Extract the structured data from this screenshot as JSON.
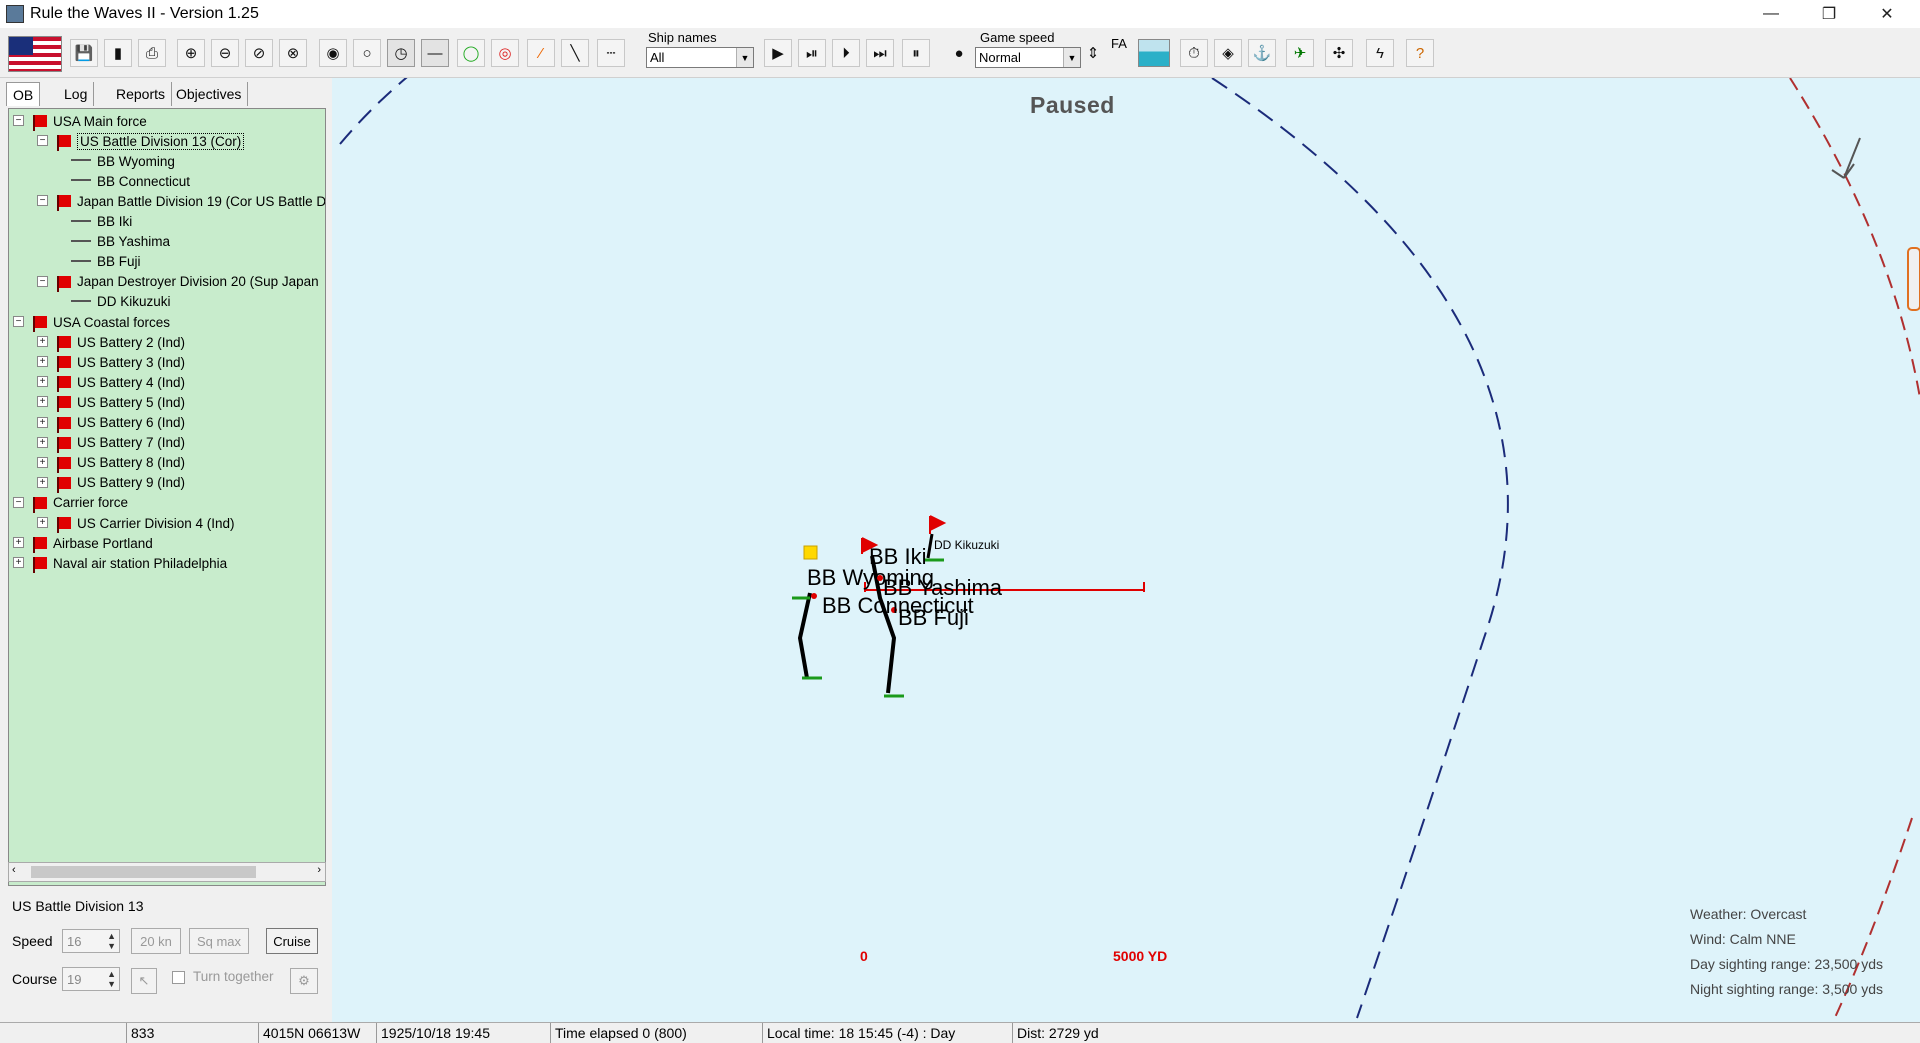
{
  "window": {
    "title": "Rule the Waves II - Version 1.25",
    "min": "—",
    "restore": "❐",
    "close": "✕"
  },
  "toolbar": {
    "ship_names_label": "Ship names",
    "ship_names_value": "All",
    "game_speed_label": "Game speed",
    "game_speed_value": "Normal",
    "fa_label": "FA"
  },
  "tabs": [
    "OB",
    "Log",
    "Reports",
    "Objectives"
  ],
  "tree": [
    {
      "label": "USA Main force",
      "level": 0,
      "exp": "−",
      "icon": "flag"
    },
    {
      "label": "US Battle Division 13 (Cor)",
      "level": 1,
      "exp": "−",
      "icon": "flag",
      "selected": true
    },
    {
      "label": "BB Wyoming",
      "level": 2,
      "icon": "ship"
    },
    {
      "label": "BB Connecticut",
      "level": 2,
      "icon": "ship"
    },
    {
      "label": "Japan Battle Division 19 (Cor US Battle D",
      "level": 1,
      "exp": "−",
      "icon": "flag"
    },
    {
      "label": "BB Iki",
      "level": 2,
      "icon": "ship"
    },
    {
      "label": "BB Yashima",
      "level": 2,
      "icon": "ship"
    },
    {
      "label": "BB Fuji",
      "level": 2,
      "icon": "ship"
    },
    {
      "label": "Japan Destroyer Division 20 (Sup Japan",
      "level": 1,
      "exp": "−",
      "icon": "flag"
    },
    {
      "label": "DD Kikuzuki",
      "level": 2,
      "icon": "ship"
    },
    {
      "label": "USA Coastal forces",
      "level": 0,
      "exp": "−",
      "icon": "flag"
    },
    {
      "label": "US Battery 2 (Ind)",
      "level": 1,
      "exp": "+",
      "icon": "flag"
    },
    {
      "label": "US Battery 3 (Ind)",
      "level": 1,
      "exp": "+",
      "icon": "flag"
    },
    {
      "label": "US Battery 4 (Ind)",
      "level": 1,
      "exp": "+",
      "icon": "flag"
    },
    {
      "label": "US Battery 5 (Ind)",
      "level": 1,
      "exp": "+",
      "icon": "flag"
    },
    {
      "label": "US Battery 6 (Ind)",
      "level": 1,
      "exp": "+",
      "icon": "flag"
    },
    {
      "label": "US Battery 7 (Ind)",
      "level": 1,
      "exp": "+",
      "icon": "flag"
    },
    {
      "label": "US Battery 8 (Ind)",
      "level": 1,
      "exp": "+",
      "icon": "flag"
    },
    {
      "label": "US Battery 9 (Ind)",
      "level": 1,
      "exp": "+",
      "icon": "flag"
    },
    {
      "label": "Carrier force",
      "level": 0,
      "exp": "−",
      "icon": "flag"
    },
    {
      "label": "US Carrier Division 4 (Ind)",
      "level": 1,
      "exp": "+",
      "icon": "flag"
    },
    {
      "label": "Airbase Portland",
      "level": 0,
      "exp": "+",
      "icon": "flag"
    },
    {
      "label": "Naval air station Philadelphia",
      "level": 0,
      "exp": "+",
      "icon": "flag"
    }
  ],
  "unit_panel": {
    "name": "US Battle Division 13",
    "speed_label": "Speed",
    "speed_value": "16",
    "btn_20kn": "20 kn",
    "btn_sqmax": "Sq max",
    "btn_cruise": "Cruise",
    "course_label": "Course",
    "course_value": "19",
    "turn_together": "Turn together"
  },
  "map": {
    "paused": "Paused",
    "ships": [
      "BB Iki",
      "BB Wyoming",
      "BB Yashima",
      "BB Connecticut",
      "BB Fuji",
      "DD Kikuzuki"
    ],
    "scale_start": "0",
    "scale_end": "5000 YD",
    "weather": "Weather: Overcast",
    "wind": "Wind: Calm  NNE",
    "day_range": "Day sighting range: 23,500 yds",
    "night_range": "Night sighting range: 3,500 yds"
  },
  "status": {
    "s1": "",
    "s2": "833",
    "s3": "4015N 06613W",
    "s4": "1925/10/18 19:45",
    "s5": "Time elapsed 0 (800)",
    "s6": "Local time: 18 15:45 (-4) : Day",
    "s7": "Dist: 2729 yd"
  }
}
